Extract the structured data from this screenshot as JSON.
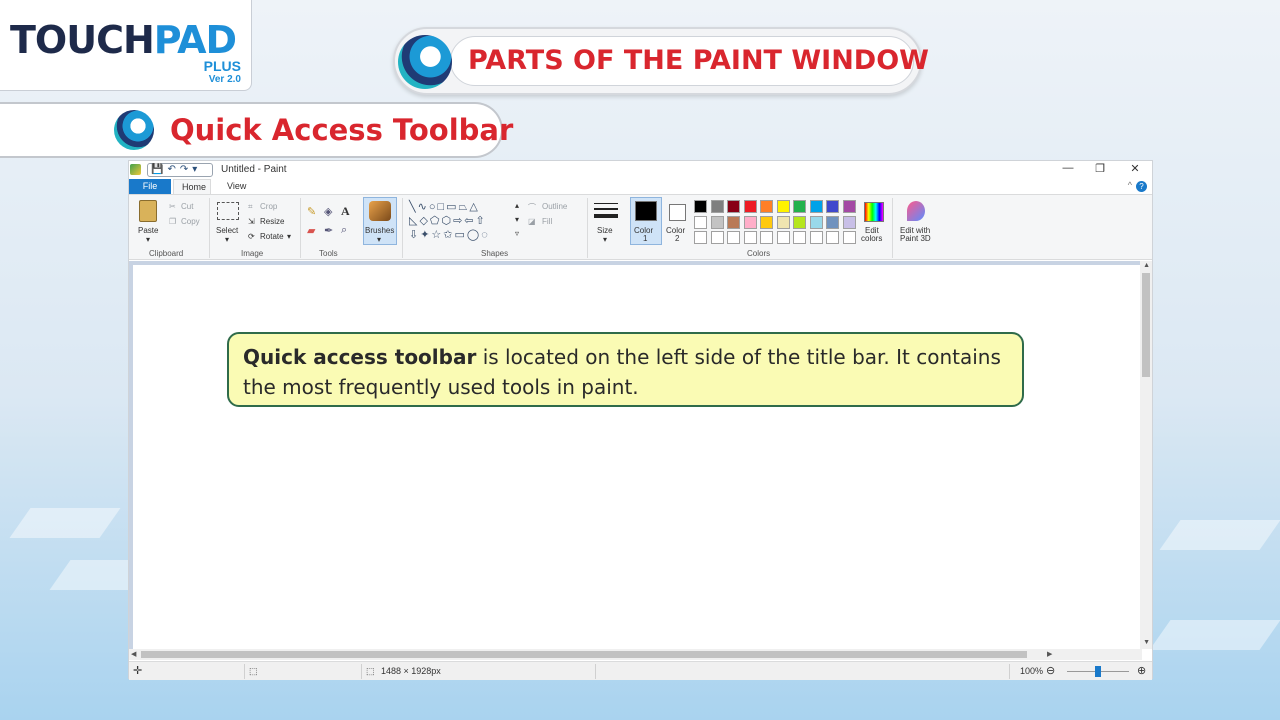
{
  "logo": {
    "word_part1": "TOUCH",
    "word_part2": "PAD",
    "plus": "PLUS",
    "version": "Ver 2.0"
  },
  "banner": {
    "title": "PARTS OF THE PAINT WINDOW"
  },
  "section": {
    "title": "Quick Access Toolbar"
  },
  "paint": {
    "window_title": "Untitled - Paint",
    "window_controls": {
      "minimize": "—",
      "restore": "❐",
      "close": "✕"
    },
    "tabs": [
      "File",
      "Home",
      "View"
    ],
    "help_icon": "?",
    "collapse_icon": "^",
    "clipboard": {
      "paste": "Paste",
      "cut": "Cut",
      "copy": "Copy",
      "label": "Clipboard"
    },
    "image": {
      "select": "Select",
      "crop": "Crop",
      "resize": "Resize",
      "rotate": "Rotate",
      "label": "Image"
    },
    "tools": {
      "label": "Tools"
    },
    "brushes": {
      "label": "Brushes"
    },
    "shapes": {
      "outline": "Outline",
      "fill": "Fill",
      "label": "Shapes"
    },
    "size": {
      "label": "Size"
    },
    "colors": {
      "color1_line1": "Color",
      "color1_line2": "1",
      "color2_line1": "Color",
      "color2_line2": "2",
      "edit_line1": "Edit",
      "edit_line2": "colors",
      "paint3d_line1": "Edit with",
      "paint3d_line2": "Paint 3D",
      "label": "Colors",
      "palette_row1": [
        "#000000",
        "#7f7f7f",
        "#880015",
        "#ed1c24",
        "#ff7f27",
        "#fff200",
        "#22b14c",
        "#00a2e8",
        "#3f48cc",
        "#a349a4"
      ],
      "palette_row2": [
        "#ffffff",
        "#c3c3c3",
        "#b97a57",
        "#ffaec9",
        "#ffc90e",
        "#efe4b0",
        "#b5e61d",
        "#99d9ea",
        "#7092be",
        "#c8bfe7"
      ],
      "palette_row3": [
        "#ffffff",
        "#ffffff",
        "#ffffff",
        "#ffffff",
        "#ffffff",
        "#ffffff",
        "#ffffff",
        "#ffffff",
        "#ffffff",
        "#ffffff"
      ]
    },
    "status": {
      "dimensions": "1488 × 1928px",
      "zoom": "100%"
    }
  },
  "callout": {
    "bold": "Quick access toolbar",
    "rest": " is located on the left side of the title bar. It contains the most frequently used tools in paint."
  },
  "icons": [
    "save-icon",
    "undo-icon",
    "redo-icon",
    "paste-icon",
    "cut-icon",
    "copy-icon",
    "select-icon",
    "crop-icon",
    "resize-icon",
    "rotate-icon",
    "pencil-icon",
    "fill-bucket-icon",
    "text-icon",
    "eraser-icon",
    "color-picker-icon",
    "magnifier-icon",
    "brush-icon",
    "size-icon",
    "edit-colors-icon",
    "paint3d-icon",
    "zoom-out-icon",
    "zoom-in-icon"
  ]
}
